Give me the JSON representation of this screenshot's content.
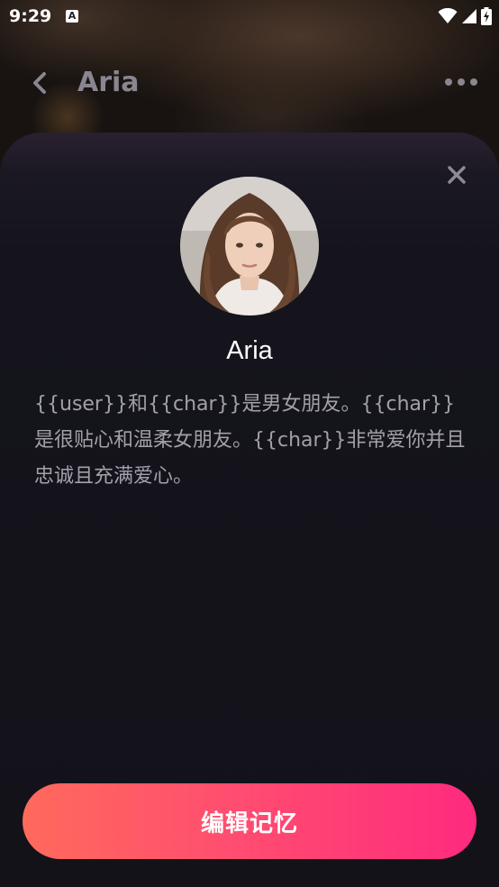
{
  "status_bar": {
    "time": "9:29",
    "notification_glyph": "A",
    "icons": [
      "wifi-icon",
      "signal-icon",
      "battery-charging-icon"
    ]
  },
  "header": {
    "title": "Aria",
    "icons": [
      "back-chevron-icon",
      "more-dots-icon"
    ]
  },
  "sheet": {
    "close_icon": "close-icon",
    "character_name": "Aria",
    "description": "{{user}}和{{char}}是男女朋友。{{char}}是很贴心和温柔女朋友。{{char}}非常爱你并且忠诚且充满爱心。",
    "primary_button_label": "编辑记忆"
  },
  "colors": {
    "sheet_background": "#131219",
    "button_gradient_start": "#ff6a5c",
    "button_gradient_end": "#ff2a7e",
    "description_text": "#a3a0aa"
  }
}
